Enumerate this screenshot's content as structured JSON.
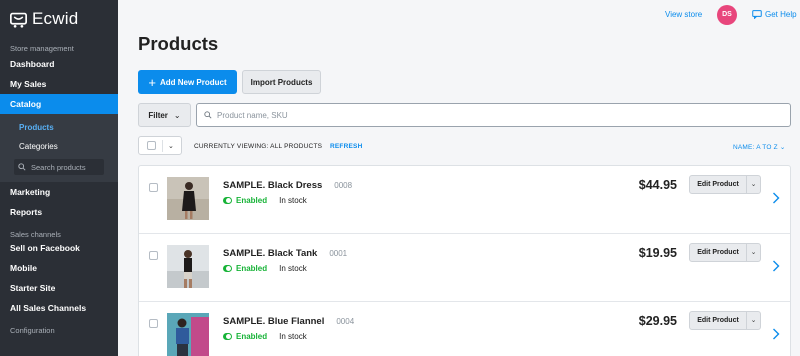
{
  "brand": {
    "name": "Ecwid"
  },
  "sidebar": {
    "store_management_label": "Store management",
    "items_top": [
      {
        "label": "Dashboard",
        "name": "sidebar-item-dashboard"
      },
      {
        "label": "My Sales",
        "name": "sidebar-item-my-sales"
      },
      {
        "label": "Catalog",
        "name": "sidebar-item-catalog"
      }
    ],
    "catalog_sub": {
      "products": "Products",
      "categories": "Categories",
      "search_placeholder": "Search products"
    },
    "items_mid": [
      {
        "label": "Marketing",
        "name": "sidebar-item-marketing"
      },
      {
        "label": "Reports",
        "name": "sidebar-item-reports"
      }
    ],
    "sales_channels_label": "Sales channels",
    "items_channels": [
      {
        "label": "Sell on Facebook",
        "name": "sidebar-item-sell-on-facebook"
      },
      {
        "label": "Mobile",
        "name": "sidebar-item-mobile"
      },
      {
        "label": "Starter Site",
        "name": "sidebar-item-starter-site"
      },
      {
        "label": "All Sales Channels",
        "name": "sidebar-item-all-sales-channels"
      }
    ],
    "configuration_label": "Configuration"
  },
  "topbar": {
    "view_store": "View store",
    "avatar_initials": "DS",
    "help": "Get Help"
  },
  "main": {
    "title": "Products",
    "add_product": "Add New Product",
    "import_products": "Import Products",
    "filter": "Filter",
    "search_placeholder": "Product name, SKU",
    "viewing": "CURRENTLY VIEWING: ALL PRODUCTS",
    "refresh": "REFRESH",
    "sort": "NAME: A TO Z"
  },
  "products": [
    {
      "name": "SAMPLE. Black Dress",
      "sku": "0008",
      "status": "Enabled",
      "stock": "In stock",
      "price": "$44.95",
      "edit": "Edit Product"
    },
    {
      "name": "SAMPLE. Black Tank",
      "sku": "0001",
      "status": "Enabled",
      "stock": "In stock",
      "price": "$19.95",
      "edit": "Edit Product"
    },
    {
      "name": "SAMPLE. Blue Flannel",
      "sku": "0004",
      "status": "Enabled",
      "stock": "In stock",
      "price": "$29.95",
      "edit": "Edit Product"
    }
  ],
  "colors": {
    "accent": "#0b8cec",
    "sidebar_bg": "#2b2f36",
    "enabled_green": "#17b337",
    "avatar_pink": "#e8467c"
  }
}
